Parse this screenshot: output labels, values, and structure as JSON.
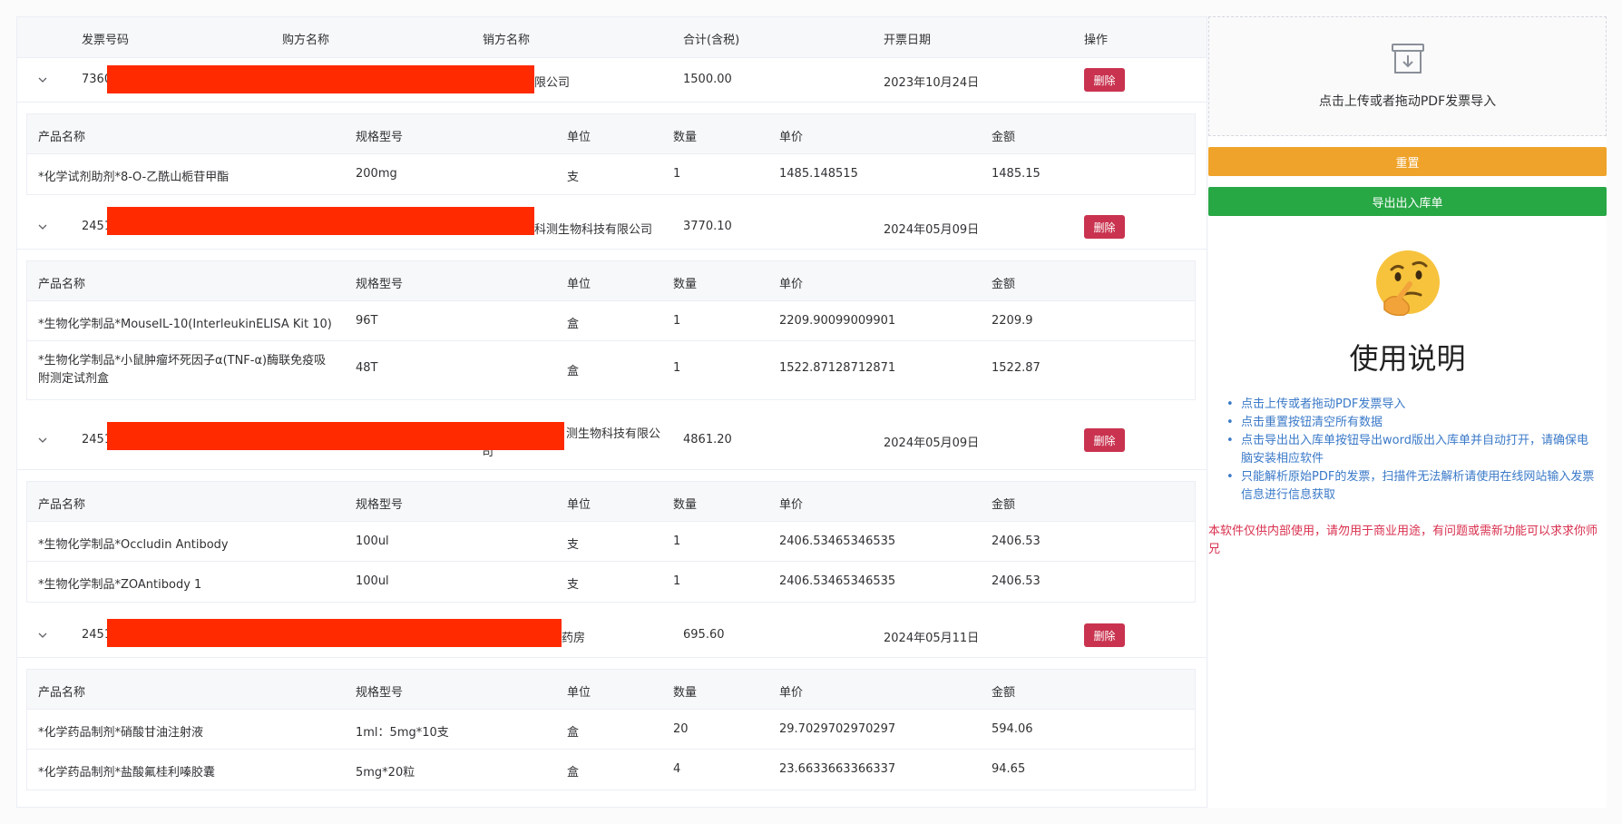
{
  "header": {
    "invoice_no": "发票号码",
    "buyer": "购方名称",
    "seller": "销方名称",
    "total": "合计(含税)",
    "date": "开票日期",
    "action": "操作"
  },
  "sub_header": {
    "name": "产品名称",
    "spec": "规格型号",
    "unit": "单位",
    "qty": "数量",
    "price": "单价",
    "amount": "金额"
  },
  "delete_label": "删除",
  "invoices": [
    {
      "no": "7360",
      "seller_tail": "物科技有限公司",
      "total": "1500.00",
      "date": "2023年10月24日",
      "items": [
        {
          "name": "*化学试剂助剂*8-O-乙酰山栀苷甲酯",
          "spec": "200mg",
          "unit": "支",
          "qty": "1",
          "price": "1485.148515",
          "amount": "1485.15"
        }
      ]
    },
    {
      "no": "2451",
      "seller_tail": "科测生物科技有限公司",
      "total": "3770.10",
      "date": "2024年05月09日",
      "items": [
        {
          "name": "*生物化学制品*MouseIL-10(InterleukinELISA Kit 10)",
          "spec": "96T",
          "unit": "盒",
          "qty": "1",
          "price": "2209.90099009901",
          "amount": "2209.9"
        },
        {
          "name": "*生物化学制品*小鼠肿瘤坏死因子α(TNF-α)酶联免疫吸附测定试剂盒",
          "spec": "48T",
          "unit": "盒",
          "qty": "1",
          "price": "1522.87128712871",
          "amount": "1522.87"
        }
      ]
    },
    {
      "no": "2451",
      "seller_tail": "测生物科技有限公",
      "seller_tail2": "司",
      "total": "4861.20",
      "date": "2024年05月09日",
      "items": [
        {
          "name": "*生物化学制品*Occludin Antibody",
          "spec": "100ul",
          "unit": "支",
          "qty": "1",
          "price": "2406.53465346535",
          "amount": "2406.53"
        },
        {
          "name": "*生物化学制品*ZOAntibody 1",
          "spec": "100ul",
          "unit": "支",
          "qty": "1",
          "price": "2406.53465346535",
          "amount": "2406.53"
        }
      ]
    },
    {
      "no": "2451",
      "seller_tail": "药房",
      "total": "695.60",
      "date": "2024年05月11日",
      "items": [
        {
          "name": "*化学药品制剂*硝酸甘油注射液",
          "spec": "1ml：5mg*10支",
          "unit": "盒",
          "qty": "20",
          "price": "29.7029702970297",
          "amount": "594.06"
        },
        {
          "name": "*化学药品制剂*盐酸氟桂利嗪胶囊",
          "spec": "5mg*20粒",
          "unit": "盒",
          "qty": "4",
          "price": "23.6633663366337",
          "amount": "94.65"
        }
      ]
    }
  ],
  "side": {
    "upload_text": "点击上传或者拖动PDF发票导入",
    "reset_label": "重置",
    "export_label": "导出出入库单",
    "title": "使用说明",
    "tips": [
      "点击上传或者拖动PDF发票导入",
      "点击重置按钮清空所有数据",
      "点击导出出入库单按钮导出word版出入库单并自动打开，请确保电脑安装相应软件",
      "只能解析原始PDF的发票，扫描件无法解析请使用在线网站输入发票信息进行信息获取"
    ],
    "note": "本软件仅供内部使用，请勿用于商业用途，有问题或需新功能可以求求你师兄"
  },
  "colors": {
    "delete": "#c9334f",
    "reset": "#efa32a",
    "export": "#28a745",
    "tip": "#3a79c8",
    "note": "#d9304f",
    "redaction": "#ff2a00"
  }
}
